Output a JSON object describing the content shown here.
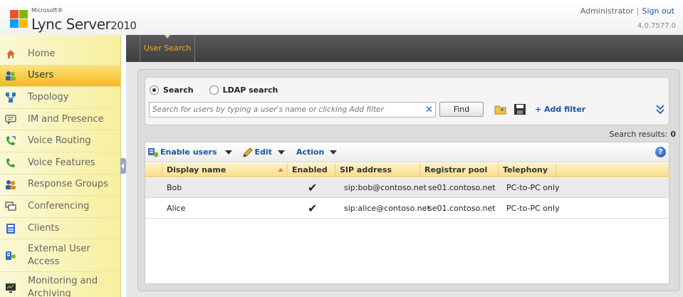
{
  "header": {
    "brand_small": "Microsoft®",
    "brand_main": "Lync Server",
    "brand_year": "2010",
    "user": "Administrator",
    "separator": "|",
    "signout": "Sign out",
    "version": "4.0.7577.0"
  },
  "sidebar": {
    "items": [
      {
        "label": "Home",
        "icon": "home-icon"
      },
      {
        "label": "Users",
        "icon": "users-icon",
        "active": true
      },
      {
        "label": "Topology",
        "icon": "topology-icon"
      },
      {
        "label": "IM and Presence",
        "icon": "chat-bubble-icon"
      },
      {
        "label": "Voice Routing",
        "icon": "phone-routing-icon"
      },
      {
        "label": "Voice Features",
        "icon": "phone-icon"
      },
      {
        "label": "Response Groups",
        "icon": "group-icon"
      },
      {
        "label": "Conferencing",
        "icon": "conference-icon"
      },
      {
        "label": "Clients",
        "icon": "clients-icon"
      },
      {
        "label": "External User Access",
        "icon": "external-access-icon"
      },
      {
        "label": "Monitoring and Archiving",
        "icon": "monitor-icon"
      }
    ]
  },
  "tabs": {
    "user_search": "User Search"
  },
  "search": {
    "mode_search": "Search",
    "mode_ldap": "LDAP search",
    "selected_mode": "Search",
    "placeholder": "Search for users by typing a user's name or clicking Add filter",
    "value": "",
    "find_label": "Find",
    "add_filter": "+ Add filter",
    "results_label": "Search results:",
    "results_count": "0"
  },
  "toolbar": {
    "enable_users": "Enable users",
    "edit": "Edit",
    "action": "Action"
  },
  "grid": {
    "columns": [
      "Display name",
      "Enabled",
      "SIP address",
      "Registrar pool",
      "Telephony"
    ],
    "rows": [
      {
        "display_name": "Bob",
        "enabled": "✔",
        "sip": "sip:bob@contoso.net",
        "pool": "se01.contoso.net",
        "telephony": "PC-to-PC only"
      },
      {
        "display_name": "Alice",
        "enabled": "✔",
        "sip": "sip:alice@contoso.net",
        "pool": "se01.contoso.net",
        "telephony": "PC-to-PC only"
      }
    ]
  },
  "colors": {
    "accent_orange": "#f7a81a",
    "link_blue": "#1a57a6",
    "nav_active": "#f6b820"
  }
}
